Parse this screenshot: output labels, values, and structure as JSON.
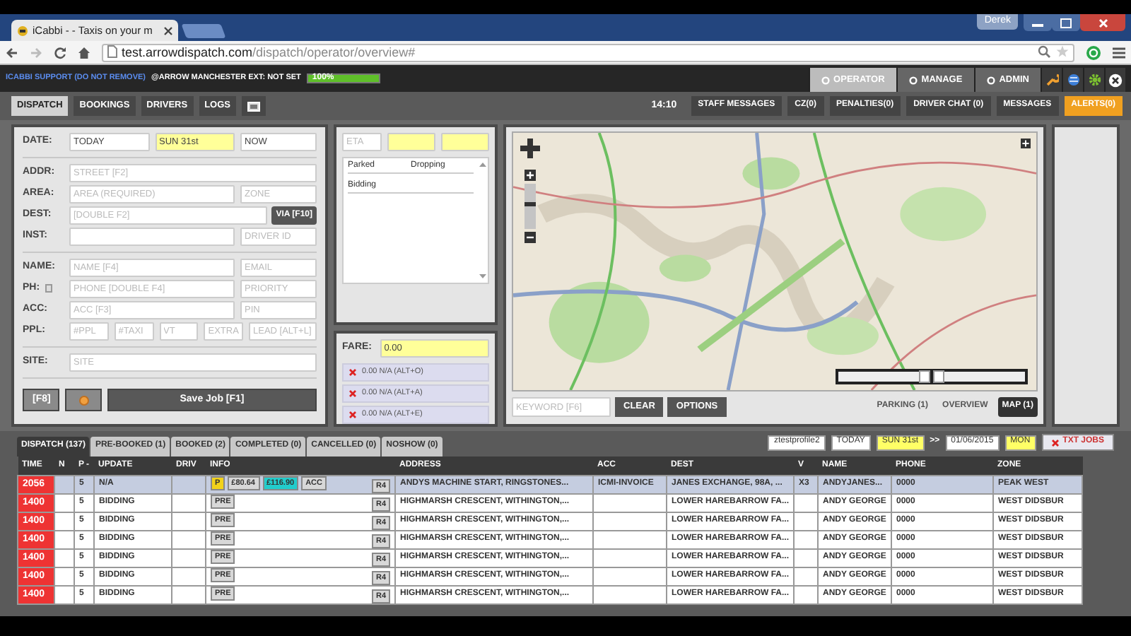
{
  "browser": {
    "tab_title": "iCabbi - - Taxis on your m",
    "user": "Derek",
    "url_host": "test.arrowdispatch.com",
    "url_path": "/dispatch/operator/overview#"
  },
  "app_bar": {
    "support": "ICABBI SUPPORT (DO NOT REMOVE)",
    "account": "@ARROW MANCHESTER EXT: NOT SET",
    "progress": {
      "label": "100%",
      "level": 1
    },
    "modes": [
      {
        "label": "OPERATOR",
        "selected": true
      },
      {
        "label": "MANAGE",
        "selected": false
      },
      {
        "label": "ADMIN",
        "selected": false
      }
    ]
  },
  "nav": {
    "tabs": [
      {
        "label": "DISPATCH",
        "selected": true
      },
      {
        "label": "BOOKINGS",
        "selected": false
      },
      {
        "label": "DRIVERS",
        "selected": false
      },
      {
        "label": "LOGS",
        "selected": false
      }
    ],
    "time": "14:10",
    "panels": [
      {
        "label": "STAFF MESSAGES",
        "alert": false
      },
      {
        "label": "CZ(0)",
        "alert": false
      },
      {
        "label": "PENALTIES(0)",
        "alert": false
      },
      {
        "label": "DRIVER CHAT (0)",
        "alert": false
      },
      {
        "label": "MESSAGES",
        "alert": false
      },
      {
        "label": "ALERTS(0)",
        "alert": true
      }
    ]
  },
  "booking_form": {
    "sections": [
      [
        {
          "label": "DATE:",
          "fields": [
            {
              "value": "TODAY",
              "highlighted": false
            },
            {
              "value": "SUN 31st",
              "highlighted": true
            },
            {
              "value": "NOW",
              "highlighted": false
            }
          ]
        }
      ],
      [
        {
          "label": "ADDR:",
          "fields": [
            {
              "placeholder": "STREET [F2]",
              "highlighted": false
            }
          ]
        },
        {
          "label": "AREA:",
          "fields": [
            {
              "placeholder": "AREA (REQUIRED)",
              "highlighted": false
            },
            {
              "placeholder": "ZONE",
              "highlighted": false
            }
          ]
        },
        {
          "label": "DEST:",
          "fields": [
            {
              "placeholder": "[DOUBLE F2]",
              "highlighted": false
            }
          ],
          "button": "VIA [F10]"
        },
        {
          "label": "INST:",
          "fields": [
            {
              "highlighted": false
            },
            {
              "placeholder": "DRIVER ID",
              "highlighted": false
            }
          ]
        }
      ],
      [
        {
          "label": "NAME:",
          "fields": [
            {
              "placeholder": "NAME [F4]",
              "highlighted": false
            },
            {
              "placeholder": "EMAIL",
              "highlighted": false
            }
          ]
        },
        {
          "label": "PH:",
          "label_icon": true,
          "fields": [
            {
              "placeholder": "PHONE [DOUBLE F4]",
              "highlighted": false
            },
            {
              "placeholder": "PRIORITY",
              "highlighted": false
            }
          ]
        },
        {
          "label": "ACC:",
          "fields": [
            {
              "placeholder": "ACC [F3]",
              "highlighted": false
            },
            {
              "placeholder": "PIN",
              "highlighted": false
            }
          ]
        },
        {
          "label": "PPL:",
          "fields": [
            {
              "placeholder": "#PPL",
              "highlighted": false
            },
            {
              "placeholder": "#TAXI",
              "highlighted": false
            },
            {
              "placeholder": "VT",
              "highlighted": false
            },
            {
              "placeholder": "EXTRA",
              "highlighted": false
            },
            {
              "placeholder": "LEAD [ALT+L]",
              "highlighted": false
            }
          ]
        }
      ],
      [
        {
          "label": "SITE:",
          "fields": [
            {
              "placeholder": "SITE",
              "highlighted": false
            }
          ]
        }
      ]
    ],
    "buttons": [
      {
        "kind": "plain",
        "label": "[F8]"
      },
      {
        "kind": "dot"
      },
      {
        "kind": "primary",
        "label": "Save Job [F1]"
      }
    ]
  },
  "jobs_panel": {
    "eta": {
      "placeholder": "ETA"
    },
    "columns": [
      "Parked",
      "Dropping"
    ],
    "rows": [
      "Bidding"
    ]
  },
  "fare": {
    "label": "FARE:",
    "value": "0.00",
    "options": [
      "0.00 N/A (ALT+O)",
      "0.00 N/A (ALT+A)",
      "0.00 N/A (ALT+E)"
    ]
  },
  "map": {
    "zoom": {
      "level": 0.55
    },
    "sliders": [
      {
        "level": 1
      },
      {
        "level": 0
      }
    ],
    "keyword": {
      "placeholder": "KEYWORD [F6]"
    },
    "buttons": [
      "CLEAR",
      "OPTIONS"
    ],
    "views": [
      {
        "label": "PARKING (1)",
        "selected": false
      },
      {
        "label": "OVERVIEW",
        "selected": false
      },
      {
        "label": "MAP (1)",
        "selected": true
      }
    ]
  },
  "job_list": {
    "tabs": [
      {
        "label": "DISPATCH (137)",
        "selected": true
      },
      {
        "label": "PRE-BOOKED (1)",
        "selected": false
      },
      {
        "label": "BOOKED (2)",
        "selected": false
      },
      {
        "label": "COMPLETED (0)",
        "selected": false
      },
      {
        "label": "CANCELLED (0)",
        "selected": false
      },
      {
        "label": "NOSHOW (0)",
        "selected": false
      }
    ],
    "filters": [
      {
        "kind": "field",
        "value": "ztestprofile2",
        "highlighted": false
      },
      {
        "kind": "field",
        "value": "TODAY",
        "highlighted": false
      },
      {
        "kind": "field",
        "value": "SUN 31st",
        "highlighted": true
      },
      {
        "kind": "text",
        "value": ">>"
      },
      {
        "kind": "field",
        "value": "01/06/2015",
        "highlighted": false
      },
      {
        "kind": "field",
        "value": "MON",
        "highlighted": true
      }
    ],
    "button": "TXT JOBS",
    "columns": [
      "TIME",
      "N",
      "P -",
      "UPDATE",
      "DRIV",
      "INFO",
      "ADDRESS",
      "ACC",
      "DEST",
      "V",
      "NAME",
      "PHONE",
      "ZONE"
    ],
    "rows": [
      {
        "selected": true,
        "color": "#ee3333",
        "time": "2056",
        "p": "5",
        "update": "N/A",
        "info": [
          {
            "text": "P",
            "color": "#f2d21a"
          },
          {
            "text": "£80.64",
            "color": "#d8d8d8"
          },
          {
            "text": "£116.90",
            "color": "#22cccc"
          },
          {
            "text": "ACC",
            "color": "#d8d8d8"
          }
        ],
        "badge": "R4",
        "address": "ANDYS MACHINE START, RINGSTONES...",
        "acc": "ICMI-INVOICE",
        "dest": "JANES EXCHANGE, 98A, ...",
        "v": "X3",
        "name": "ANDYJANES...",
        "phone": "0000",
        "zone": "PEAK WEST"
      },
      {
        "selected": false,
        "color": "#ee3333",
        "time": "1400",
        "p": "5",
        "update": "BIDDING",
        "info": [
          {
            "text": "PRE",
            "color": "#d8d8d8"
          }
        ],
        "badge": "R4",
        "address": "HIGHMARSH CRESCENT, WITHINGTON,...",
        "dest": "LOWER HAREBARROW FA...",
        "name": "ANDY GEORGE",
        "phone": "0000",
        "zone": "WEST DIDSBUR"
      },
      {
        "selected": false,
        "color": "#ee3333",
        "time": "1400",
        "p": "5",
        "update": "BIDDING",
        "info": [
          {
            "text": "PRE",
            "color": "#d8d8d8"
          }
        ],
        "badge": "R4",
        "address": "HIGHMARSH CRESCENT, WITHINGTON,...",
        "dest": "LOWER HAREBARROW FA...",
        "name": "ANDY GEORGE",
        "phone": "0000",
        "zone": "WEST DIDSBUR"
      },
      {
        "selected": false,
        "color": "#ee3333",
        "time": "1400",
        "p": "5",
        "update": "BIDDING",
        "info": [
          {
            "text": "PRE",
            "color": "#d8d8d8"
          }
        ],
        "badge": "R4",
        "address": "HIGHMARSH CRESCENT, WITHINGTON,...",
        "dest": "LOWER HAREBARROW FA...",
        "name": "ANDY GEORGE",
        "phone": "0000",
        "zone": "WEST DIDSBUR"
      },
      {
        "selected": false,
        "color": "#ee3333",
        "time": "1400",
        "p": "5",
        "update": "BIDDING",
        "info": [
          {
            "text": "PRE",
            "color": "#d8d8d8"
          }
        ],
        "badge": "R4",
        "address": "HIGHMARSH CRESCENT, WITHINGTON,...",
        "dest": "LOWER HAREBARROW FA...",
        "name": "ANDY GEORGE",
        "phone": "0000",
        "zone": "WEST DIDSBUR"
      },
      {
        "selected": false,
        "color": "#ee3333",
        "time": "1400",
        "p": "5",
        "update": "BIDDING",
        "info": [
          {
            "text": "PRE",
            "color": "#d8d8d8"
          }
        ],
        "badge": "R4",
        "address": "HIGHMARSH CRESCENT, WITHINGTON,...",
        "dest": "LOWER HAREBARROW FA...",
        "name": "ANDY GEORGE",
        "phone": "0000",
        "zone": "WEST DIDSBUR"
      },
      {
        "selected": false,
        "color": "#ee3333",
        "time": "1400",
        "p": "5",
        "update": "BIDDING",
        "info": [
          {
            "text": "PRE",
            "color": "#d8d8d8"
          }
        ],
        "badge": "R4",
        "address": "HIGHMARSH CRESCENT, WITHINGTON,...",
        "dest": "LOWER HAREBARROW FA...",
        "name": "ANDY GEORGE",
        "phone": "0000",
        "zone": "WEST DIDSBUR"
      }
    ]
  }
}
